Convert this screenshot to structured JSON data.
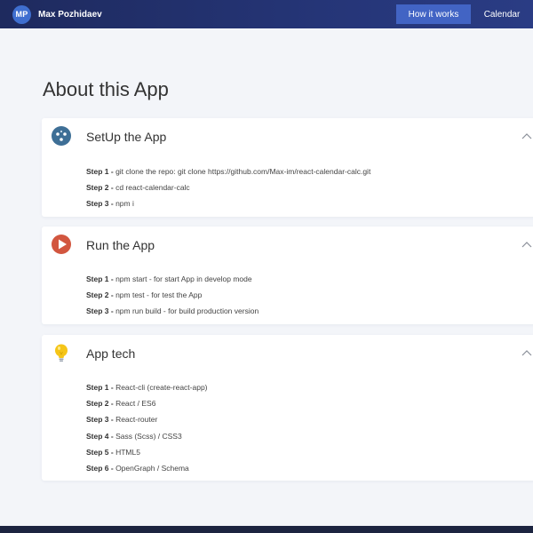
{
  "navbar": {
    "avatar_initials": "MP",
    "user_name": "Max Pozhidaev",
    "links": [
      {
        "label": "How it works",
        "active": true
      },
      {
        "label": "Calendar",
        "active": false
      }
    ]
  },
  "page": {
    "title": "About this App"
  },
  "sections": [
    {
      "title": "SetUp the App",
      "icon": "setup-icon",
      "icon_color": "#3e6f96",
      "expanded": true,
      "steps": [
        {
          "label": "Step 1 - ",
          "text": "git clone the repo: git clone https://github.com/Max-im/react-calendar-calc.git"
        },
        {
          "label": "Step 2 - ",
          "text": "cd react-calendar-calc"
        },
        {
          "label": "Step 3 - ",
          "text": "npm i"
        }
      ]
    },
    {
      "title": "Run the App",
      "icon": "play-icon",
      "icon_color": "#d9534f",
      "expanded": true,
      "steps": [
        {
          "label": "Step 1 - ",
          "text": "npm start - for start App in develop mode"
        },
        {
          "label": "Step 2 - ",
          "text": "npm test - for test the App"
        },
        {
          "label": "Step 3 - ",
          "text": "npm run build - for build production version"
        }
      ]
    },
    {
      "title": "App tech",
      "icon": "lightbulb-icon",
      "icon_color": "#f5c518",
      "expanded": true,
      "steps": [
        {
          "label": "Step 1 - ",
          "text": "React-cli (create-react-app)"
        },
        {
          "label": "Step 2 - ",
          "text": "React / ES6"
        },
        {
          "label": "Step 3 - ",
          "text": "React-router"
        },
        {
          "label": "Step 4 - ",
          "text": "Sass (Scss) / CSS3"
        },
        {
          "label": "Step 5 - ",
          "text": "HTML5"
        },
        {
          "label": "Step 6 - ",
          "text": "OpenGraph / Schema"
        }
      ]
    }
  ]
}
